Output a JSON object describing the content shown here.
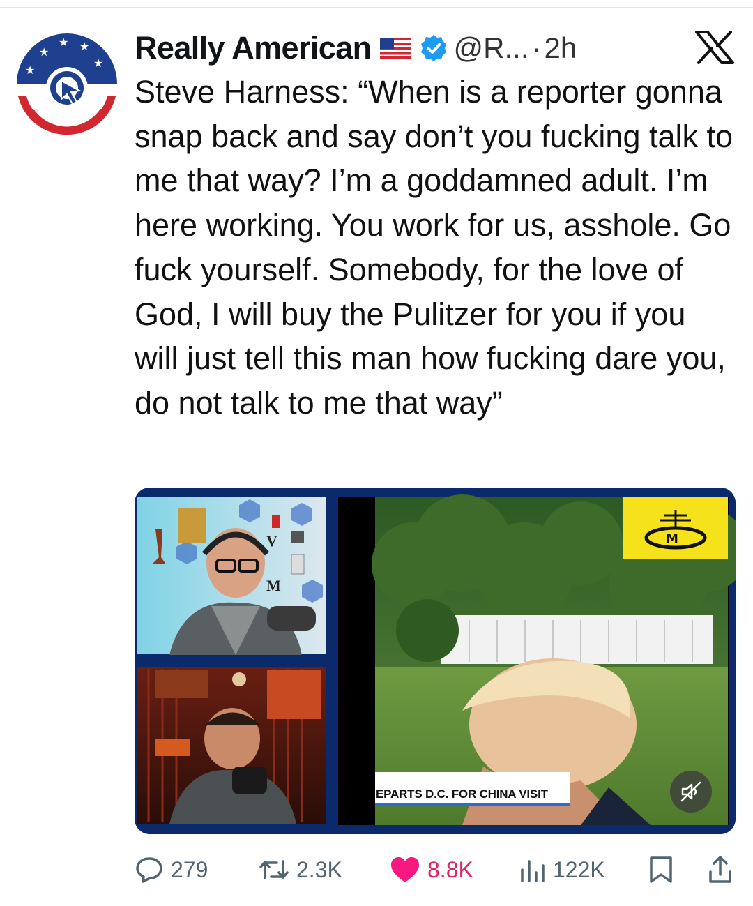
{
  "account": {
    "name": "Really American",
    "handle": "@R...",
    "separator": "·",
    "time": "2h",
    "flag_icon": "us-flag-icon",
    "verified_icon": "verified-badge-icon"
  },
  "tweet": {
    "text": "Steve Harness: “When is a reporter gonna snap back and say don’t you fucking talk to me that way? I’m a goddamned adult. I’m here working. You work for us, asshole. Go fuck yourself. Somebody, for the love of God, I will buy the Pulitzer for you if you will just tell this man how fucking dare you, do not talk to me that way”"
  },
  "media": {
    "ticker": "EPARTS D.C. FOR CHINA VISIT",
    "sign_letters": [
      "V",
      "M"
    ],
    "mute_icon": "muted-speaker-icon"
  },
  "actions": {
    "replies": "279",
    "reposts": "2.3K",
    "likes": "8.8K",
    "views": "122K"
  },
  "colors": {
    "like": "#e0245e",
    "verified": "#1d9bf0",
    "muted_text": "#536471",
    "media_frame": "#0a2a6b"
  }
}
